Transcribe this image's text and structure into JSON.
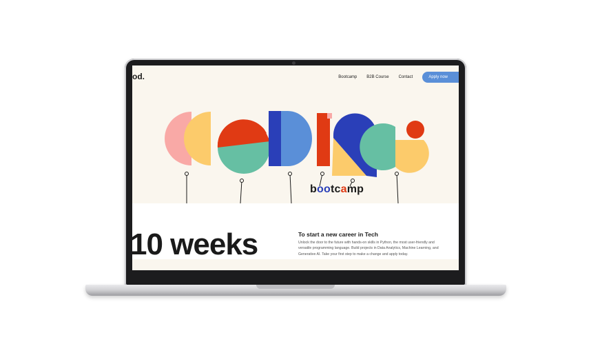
{
  "site": {
    "logo": "od.",
    "nav": {
      "links": [
        "Bootcamp",
        "B2B Course",
        "Contact"
      ],
      "cta": "Apply now"
    }
  },
  "hero": {
    "art_word": "coding",
    "brand_word_parts": [
      "b",
      "oo",
      "tc",
      "a",
      "mp"
    ]
  },
  "content": {
    "headline": "10 weeks",
    "tagline": "To start a new career in Tech",
    "description": "Unlock the door to the future with hands-on skills in Python, the most user-friendly and versatile programming language. Build projects in Data Analytics, Machine Learning, and Generative AI. Take your first step to make a change and apply today."
  },
  "colors": {
    "background": "#faf6ee",
    "accent_blue": "#5a8fd8",
    "red": "#e03a14",
    "deep_blue": "#2a3fb8",
    "green": "#66bfa3",
    "yellow": "#fccb6b",
    "pink": "#f9a9a6"
  }
}
